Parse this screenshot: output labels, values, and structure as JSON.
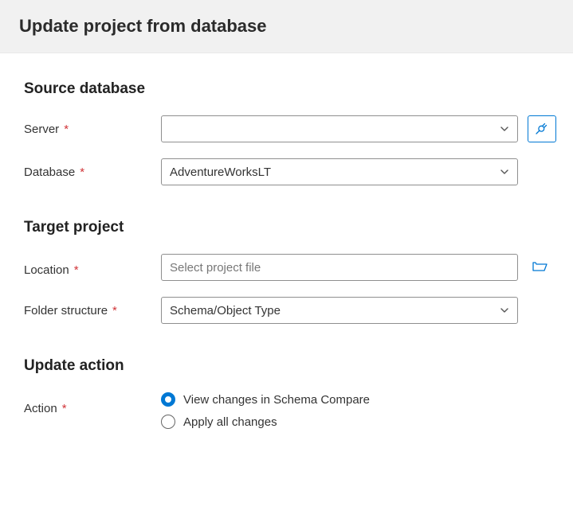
{
  "header": {
    "title": "Update project from database"
  },
  "source": {
    "section_title": "Source database",
    "server_label": "Server",
    "server_value": "",
    "database_label": "Database",
    "database_value": "AdventureWorksLT"
  },
  "target": {
    "section_title": "Target project",
    "location_label": "Location",
    "location_placeholder": "Select project file",
    "folder_label": "Folder structure",
    "folder_value": "Schema/Object Type"
  },
  "action": {
    "section_title": "Update action",
    "action_label": "Action",
    "options": [
      {
        "label": "View changes in Schema Compare",
        "selected": true
      },
      {
        "label": "Apply all changes",
        "selected": false
      }
    ]
  },
  "required_mark": "*"
}
